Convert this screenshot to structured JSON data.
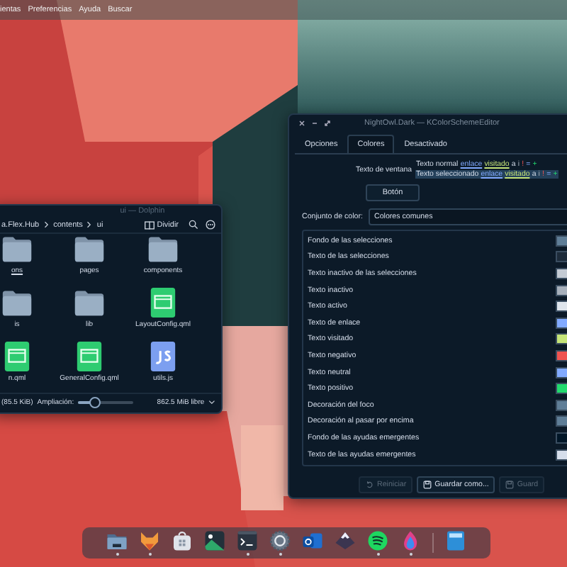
{
  "menu_bar": {
    "items": [
      "ientas",
      "Preferencias",
      "Ayuda",
      "Buscar"
    ]
  },
  "file_manager": {
    "title": "ui — Dolphin",
    "breadcrumb": [
      "a.Flex.Hub",
      "contents",
      "ui"
    ],
    "split_label": "Dividir",
    "files": [
      {
        "name": "ons",
        "kind": "folder",
        "hovered": true
      },
      {
        "name": "pages",
        "kind": "folder",
        "hovered": false
      },
      {
        "name": "components",
        "kind": "folder",
        "hovered": false
      },
      {
        "name": "is",
        "kind": "folder",
        "hovered": false
      },
      {
        "name": "lib",
        "kind": "folder",
        "hovered": false
      },
      {
        "name": "LayoutConfig.qml",
        "kind": "qml",
        "hovered": false
      },
      {
        "name": "n.qml",
        "kind": "qml",
        "hovered": false
      },
      {
        "name": "GeneralConfig.qml",
        "kind": "qml",
        "hovered": false
      },
      {
        "name": "utils.js",
        "kind": "js",
        "hovered": false
      }
    ],
    "status": {
      "size": "(85.5 KiB)",
      "zoom_label": "Ampliación:",
      "level": 0.3,
      "free": "862.5 MiB libre"
    }
  },
  "editor": {
    "title": "NightOwl.Dark — KColorSchemeEditor",
    "tabs": [
      {
        "label": "Opciones",
        "selected": false
      },
      {
        "label": "Colores",
        "selected": true
      },
      {
        "label": "Desactivado",
        "selected": false
      }
    ],
    "preview_label": "Texto de ventana",
    "preview_lines": [
      {
        "selected": false,
        "segments": [
          {
            "text": "Texto normal",
            "kind": "normal"
          },
          {
            "text": "enlace",
            "kind": "link"
          },
          {
            "text": "visitado",
            "kind": "visited"
          },
          {
            "text": "a",
            "kind": "normal"
          },
          {
            "text": "i",
            "kind": "inactive"
          },
          {
            "text": "!",
            "kind": "negative"
          },
          {
            "text": "=",
            "kind": "neutral"
          },
          {
            "text": "+",
            "kind": "positive"
          }
        ]
      },
      {
        "selected": true,
        "segments": [
          {
            "text": "Texto seleccionado",
            "kind": "normal"
          },
          {
            "text": "enlace",
            "kind": "link"
          },
          {
            "text": "visitado",
            "kind": "visited"
          },
          {
            "text": "a",
            "kind": "normal"
          },
          {
            "text": "i",
            "kind": "inactive"
          },
          {
            "text": "!",
            "kind": "negative"
          },
          {
            "text": "=",
            "kind": "neutral"
          },
          {
            "text": "+",
            "kind": "positive"
          }
        ]
      }
    ],
    "preview_button": "Botón",
    "color_set_label": "Conjunto de color:",
    "color_set_value": "Colores comunes",
    "roles": [
      {
        "name": "Fondo de las selecciones",
        "color": "#5f7e97"
      },
      {
        "name": "Texto de las selecciones",
        "color": "#1d2b3a"
      },
      {
        "name": "Texto inactivo de las selecciones",
        "color": "#c3cad3"
      },
      {
        "name": "Texto inactivo",
        "color": "#a7b0bb"
      },
      {
        "name": "Texto activo",
        "color": "#dfe5ec"
      },
      {
        "name": "Texto de enlace",
        "color": "#82aaff"
      },
      {
        "name": "Texto visitado",
        "color": "#c5e478"
      },
      {
        "name": "Texto negativo",
        "color": "#ef5350"
      },
      {
        "name": "Texto neutral",
        "color": "#82aaff"
      },
      {
        "name": "Texto positivo",
        "color": "#22da6e"
      },
      {
        "name": "Decoración del foco",
        "color": "#5f7e97"
      },
      {
        "name": "Decoración al pasar por encima",
        "color": "#5f7e97"
      },
      {
        "name": "Fondo de las ayudas emergentes",
        "color": "#011627"
      },
      {
        "name": "Texto de las ayudas emergentes",
        "color": "#d6deeb"
      }
    ],
    "buttons": [
      {
        "label": "Reiniciar",
        "disabled": true
      },
      {
        "label": "Guardar como...",
        "disabled": false
      },
      {
        "label": "Guard",
        "disabled": true
      }
    ]
  },
  "dock": [
    {
      "kind": "folder",
      "running": true
    },
    {
      "kind": "fox",
      "running": true
    },
    {
      "kind": "store",
      "running": false
    },
    {
      "kind": "image",
      "running": false
    },
    {
      "kind": "terminal",
      "running": true
    },
    {
      "kind": "gear",
      "running": true
    },
    {
      "kind": "mail",
      "running": false
    },
    {
      "kind": "mountain",
      "running": false
    },
    {
      "kind": "music",
      "running": true
    },
    {
      "kind": "flame",
      "running": true
    },
    {
      "kind": "calculator",
      "running": false
    }
  ]
}
